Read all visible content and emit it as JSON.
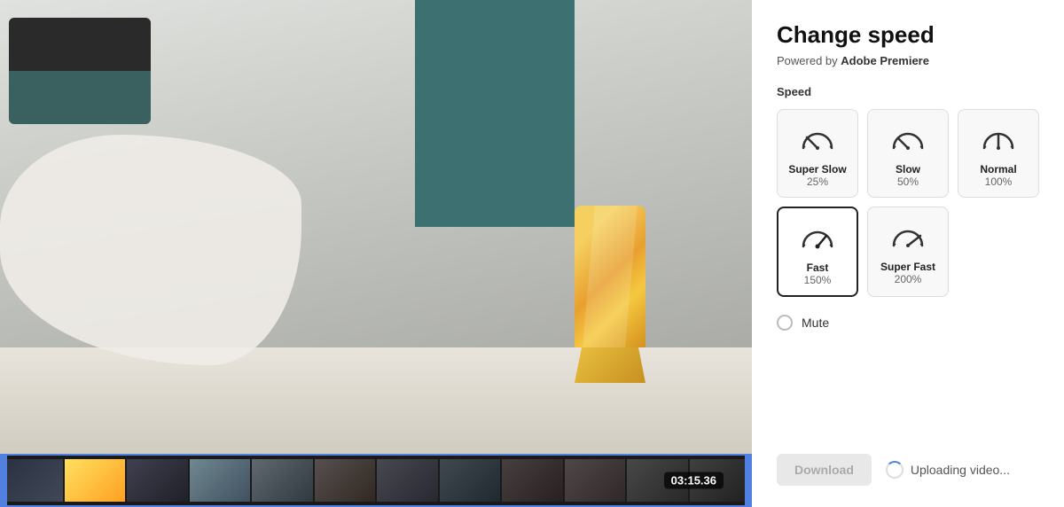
{
  "header": {
    "title": "Change speed",
    "subtitle": "Powered by ",
    "brand": "Adobe Premiere"
  },
  "speed_section": {
    "label": "Speed",
    "cards": [
      {
        "id": "super-slow",
        "name": "Super Slow",
        "pct": "25%",
        "selected": false
      },
      {
        "id": "slow",
        "name": "Slow",
        "pct": "50%",
        "selected": false
      },
      {
        "id": "normal",
        "name": "Normal",
        "pct": "100%",
        "selected": false
      },
      {
        "id": "fast",
        "name": "Fast",
        "pct": "150%",
        "selected": true
      },
      {
        "id": "super-fast",
        "name": "Super Fast",
        "pct": "200%",
        "selected": false
      }
    ]
  },
  "mute": {
    "label": "Mute",
    "checked": false
  },
  "actions": {
    "download_label": "Download",
    "uploading_label": "Uploading video..."
  },
  "timeline": {
    "timestamp": "03:15.36"
  }
}
